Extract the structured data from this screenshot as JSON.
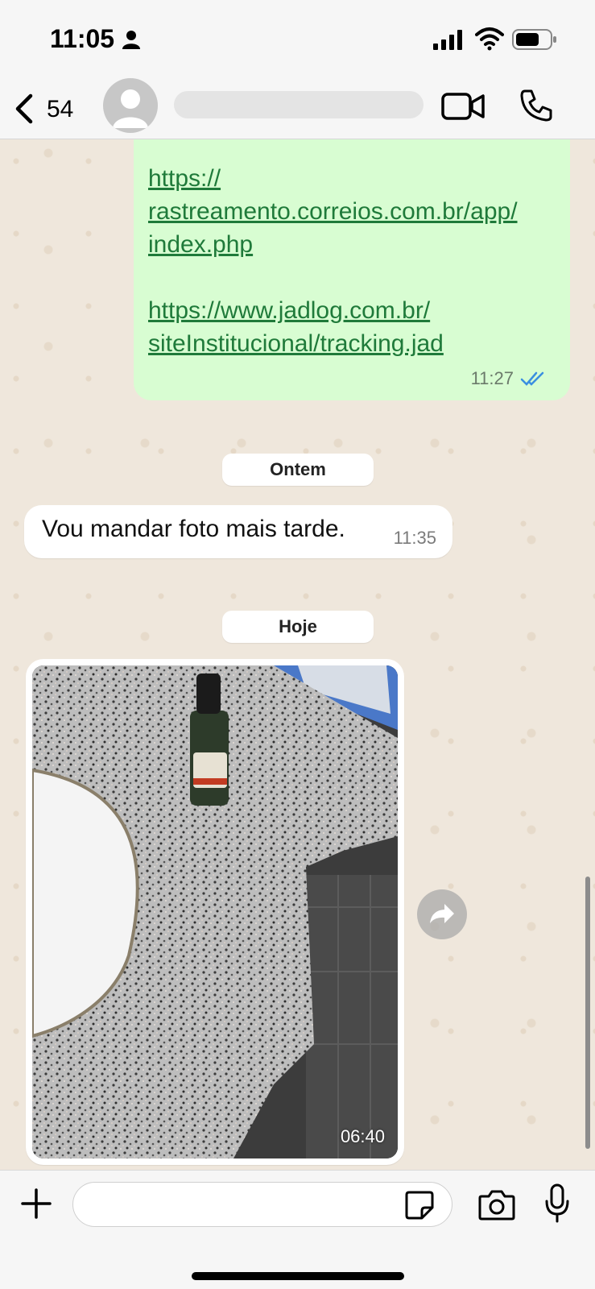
{
  "status_bar": {
    "time": "11:05",
    "icons": [
      "person-icon",
      "signal-icon",
      "wifi-icon",
      "battery-icon"
    ]
  },
  "header": {
    "back_count": "54",
    "icons": [
      "chevron-left-icon",
      "avatar",
      "video-camera-icon",
      "phone-icon"
    ]
  },
  "messages": {
    "outgoing": {
      "links": [
        "https://rastreamento.correios.com.br/app/index.php",
        "https://www.jadlog.com.br/siteInstitucional/tracking.jad"
      ],
      "link_lines": [
        [
          "https://",
          "rastreamento.correios.com.br/app/",
          "index.php"
        ],
        [
          "https://www.jadlog.com.br/",
          "siteInstitucional/tracking.jad"
        ]
      ],
      "time": "11:27",
      "status": "read"
    },
    "date_ontem": "Ontem",
    "incoming": {
      "text": "Vou mandar foto mais tarde.",
      "time": "11:35"
    },
    "date_hoje": "Hoje",
    "image": {
      "time": "06:40"
    }
  },
  "composer": {
    "input_value": "",
    "input_placeholder": "",
    "icons": [
      "plus-icon",
      "sticker-icon",
      "camera-icon",
      "microphone-icon"
    ]
  },
  "colors": {
    "outgoing_bubble": "#d8fdd2",
    "incoming_bubble": "#ffffff",
    "link": "#1f7a3a",
    "read_ticks": "#3b8fe0",
    "chat_background": "#efe7dc"
  }
}
